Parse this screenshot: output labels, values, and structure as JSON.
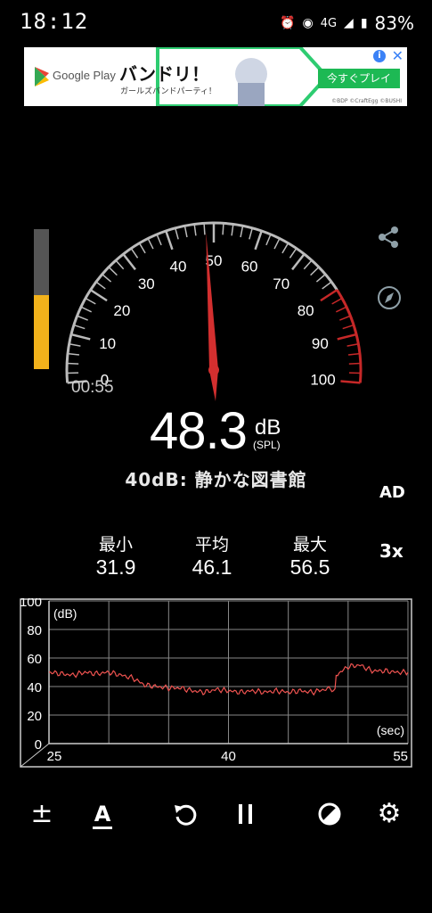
{
  "status_bar": {
    "time": "18:12",
    "network": "4G",
    "battery": "83%"
  },
  "ad": {
    "store": "Google Play",
    "title": "バンドリ！",
    "subtitle": "ガールズバンドパーティ！",
    "button": "今すぐプレイ",
    "copyright": "©BDP ©CraftEgg ©BUSHI"
  },
  "meter": {
    "dial_labels": [
      "0",
      "10",
      "20",
      "30",
      "40",
      "50",
      "60",
      "70",
      "80",
      "90",
      "100"
    ],
    "needle_value": 48.3,
    "level_fraction": 0.53,
    "timer": "00:55",
    "reading": "48.3",
    "unit": "dB",
    "unit_sub": "(SPL)",
    "reference": "40dB: 静かな図書館",
    "ad_label": "AD"
  },
  "stats": {
    "min_label": "最小",
    "min_value": "31.9",
    "avg_label": "平均",
    "avg_value": "46.1",
    "max_label": "最大",
    "max_value": "56.5",
    "speed": "3x"
  },
  "graph": {
    "y_ticks": [
      "100",
      "80",
      "60",
      "40",
      "20",
      "0"
    ],
    "x_ticks": [
      "25",
      "40",
      "55"
    ],
    "unit_y": "(dB)",
    "unit_x": "(sec)"
  },
  "chart_data": {
    "type": "line",
    "xlabel": "(sec)",
    "ylabel": "(dB)",
    "xlim": [
      25,
      55
    ],
    "ylim": [
      0,
      100
    ],
    "series": [
      {
        "values": [
          [
            25,
            50
          ],
          [
            26,
            49
          ],
          [
            27,
            48
          ],
          [
            28,
            50
          ],
          [
            29,
            49
          ],
          [
            30,
            50
          ],
          [
            31,
            48
          ],
          [
            32,
            46
          ],
          [
            33,
            41
          ],
          [
            34,
            40
          ],
          [
            35,
            39
          ],
          [
            36,
            39
          ],
          [
            37,
            37
          ],
          [
            38,
            36
          ],
          [
            39,
            38
          ],
          [
            40,
            37
          ],
          [
            41,
            36
          ],
          [
            42,
            37
          ],
          [
            43,
            36
          ],
          [
            44,
            37
          ],
          [
            45,
            36
          ],
          [
            46,
            37
          ],
          [
            47,
            36
          ],
          [
            48,
            38
          ],
          [
            48.9,
            38
          ],
          [
            49,
            48
          ],
          [
            50,
            54
          ],
          [
            51,
            55
          ],
          [
            52,
            51
          ],
          [
            53,
            51
          ],
          [
            54,
            50
          ],
          [
            55,
            50
          ]
        ]
      }
    ]
  },
  "icons": {
    "share": "share-icon",
    "compass": "compass-icon",
    "calibrate": "plus-minus-icon",
    "text": "text-size-icon",
    "reset": "reset-icon",
    "pause": "pause-icon",
    "theme": "contrast-icon",
    "settings": "gear-icon"
  },
  "colors": {
    "needle": "#d32f2f",
    "level": "#f2b21b",
    "graph_line": "#ef5350",
    "ad_button": "#1db954"
  }
}
